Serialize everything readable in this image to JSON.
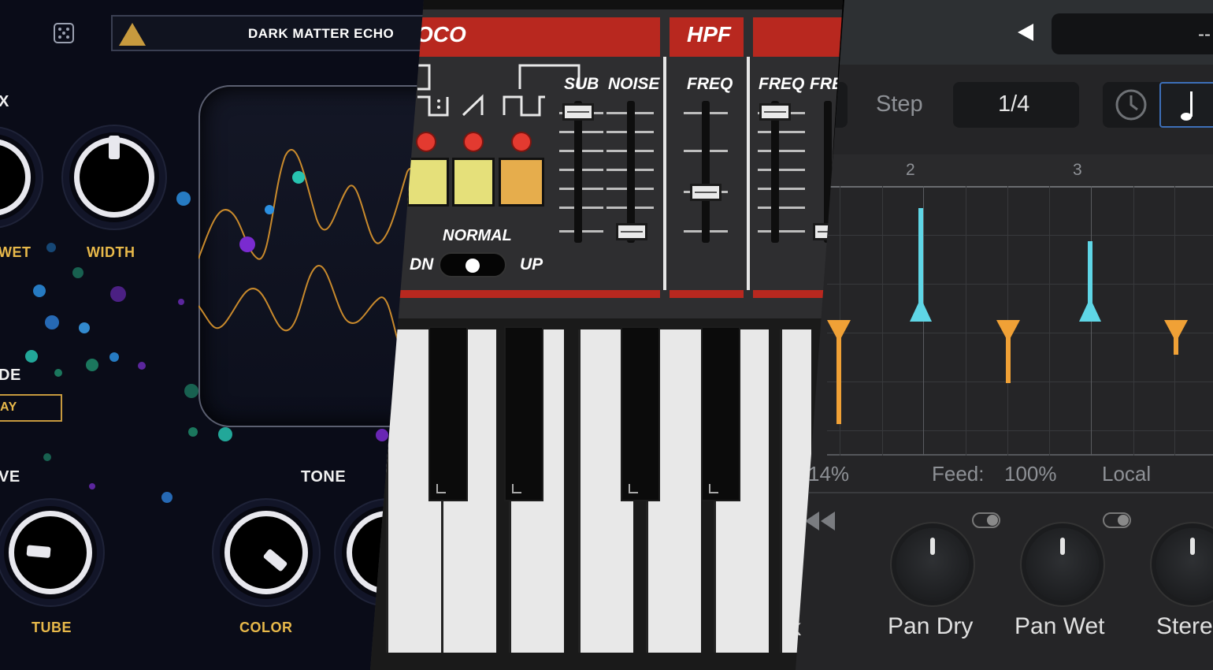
{
  "left_panel": {
    "preset_name": "DARK MATTER ECHO",
    "labels": {
      "section_top": "X",
      "wet": "WET",
      "width": "WIDTH",
      "mode": "DE",
      "mode_value": "AY",
      "drive": "VE",
      "tone": "TONE",
      "tube": "TUBE",
      "color": "COLOR"
    },
    "colors": {
      "gold": "#e8b94a",
      "accent_orange": "#c98a2c"
    },
    "icons": [
      "dice-icon",
      "warning-triangle-icon"
    ]
  },
  "middle_panel": {
    "headers": {
      "osc": "OCO",
      "hpf": "HPF"
    },
    "labels": {
      "sub": "SUB",
      "noise": "NOISE",
      "hpf_freq": "FREQ",
      "vcf_freq": "FREQ",
      "vcf_res": "FRE",
      "range": "NORMAL",
      "down": "DN",
      "up": "UP"
    },
    "colors": {
      "red": "#b8281f",
      "pad_yellow": "#e5e07a",
      "pad_orange": "#e6ad4c"
    }
  },
  "right_panel": {
    "display_text": "--",
    "step_label": "Step",
    "step_value": "1/4",
    "grid_numbers": [
      "2",
      "3"
    ],
    "readout": {
      "left_value": "14%",
      "feed_label": "Feed:",
      "feed_value": "100%",
      "mode": "Local"
    },
    "knob_labels": [
      "Pan Dry",
      "Pan Wet",
      "Stere"
    ],
    "partial_label": "k",
    "icons": [
      "back-arrow-icon",
      "clock-icon",
      "note-icon",
      "rewind-icon"
    ],
    "colors": {
      "cyan": "#5fd6e6",
      "orange": "#f0a136",
      "note_active": "#3d6fb8"
    }
  }
}
